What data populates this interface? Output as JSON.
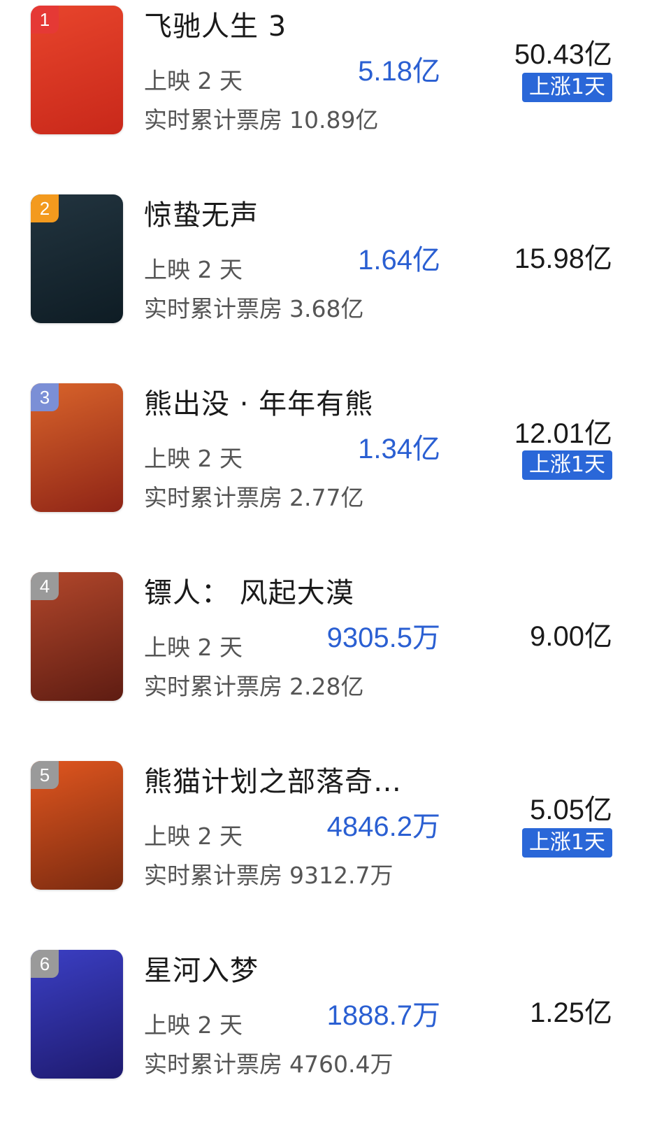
{
  "movies": [
    {
      "rank": "1",
      "title": "飞驰人生 3",
      "days": "上映 2 天",
      "cumulative_label": "实时累计票房",
      "cumulative_value": "10.89亿",
      "daily_box": "5.18亿",
      "total_box": "50.43亿",
      "trend_badge": "上涨1天",
      "poster_text": "",
      "rank_color": "#e53935",
      "poster_colors": [
        "#e8452c",
        "#c8281a"
      ]
    },
    {
      "rank": "2",
      "title": "惊蛰无声",
      "days": "上映 2 天",
      "cumulative_label": "实时累计票房",
      "cumulative_value": "3.68亿",
      "daily_box": "1.64亿",
      "total_box": "15.98亿",
      "trend_badge": "",
      "poster_text": "",
      "rank_color": "#f39a1e",
      "poster_colors": [
        "#22343f",
        "#0e1c24"
      ]
    },
    {
      "rank": "3",
      "title": "熊出没 · 年年有熊",
      "days": "上映 2 天",
      "cumulative_label": "实时累计票房",
      "cumulative_value": "2.77亿",
      "daily_box": "1.34亿",
      "total_box": "12.01亿",
      "trend_badge": "上涨1天",
      "poster_text": "",
      "rank_color": "#7b8fd6",
      "poster_colors": [
        "#d9642b",
        "#8e2416"
      ]
    },
    {
      "rank": "4",
      "title": "镖人：  风起大漠",
      "days": "上映 2 天",
      "cumulative_label": "实时累计票房",
      "cumulative_value": "2.28亿",
      "daily_box": "9305.5万",
      "total_box": "9.00亿",
      "trend_badge": "",
      "poster_text": "",
      "rank_color": "#9a9a9a",
      "poster_colors": [
        "#b2472b",
        "#5e1c12"
      ]
    },
    {
      "rank": "5",
      "title": "熊猫计划之部落奇…",
      "days": "上映 2 天",
      "cumulative_label": "实时累计票房",
      "cumulative_value": "9312.7万",
      "daily_box": "4846.2万",
      "total_box": "5.05亿",
      "trend_badge": "上涨1天",
      "poster_text": "",
      "rank_color": "#9a9a9a",
      "poster_colors": [
        "#e0561f",
        "#7a2a10"
      ]
    },
    {
      "rank": "6",
      "title": "星河入梦",
      "days": "上映 2 天",
      "cumulative_label": "实时累计票房",
      "cumulative_value": "4760.4万",
      "daily_box": "1888.7万",
      "total_box": "1.25亿",
      "trend_badge": "",
      "poster_text": "",
      "rank_color": "#9a9a9a",
      "poster_colors": [
        "#3b3fc4",
        "#1e1a6e"
      ]
    }
  ]
}
